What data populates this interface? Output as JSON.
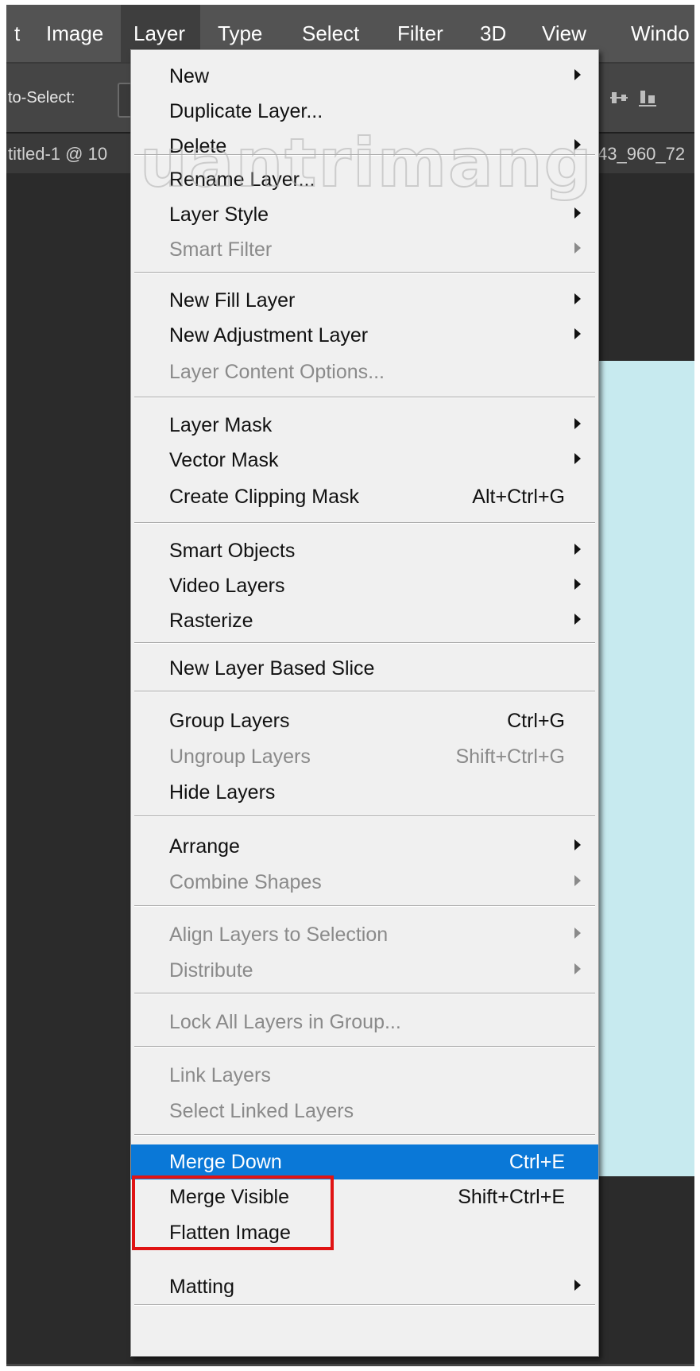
{
  "menubar": {
    "items": [
      {
        "label": "t"
      },
      {
        "label": "Image"
      },
      {
        "label": "Layer"
      },
      {
        "label": "Type"
      },
      {
        "label": "Select"
      },
      {
        "label": "Filter"
      },
      {
        "label": "3D"
      },
      {
        "label": "View"
      },
      {
        "label": "Windo"
      }
    ]
  },
  "options": {
    "label": "to-Select:"
  },
  "tabs": {
    "left": "titled-1 @ 10",
    "right": "43_960_72"
  },
  "watermark": "uantrimang",
  "layer_menu": {
    "items": [
      {
        "label": "New",
        "shortcut": "",
        "submenu": true,
        "disabled": false
      },
      {
        "label": "Duplicate Layer...",
        "shortcut": "",
        "submenu": false,
        "disabled": false
      },
      {
        "label": "Delete",
        "shortcut": "",
        "submenu": true,
        "disabled": false
      },
      {
        "label": "Rename Layer...",
        "shortcut": "",
        "submenu": false,
        "disabled": false
      },
      {
        "label": "Layer Style",
        "shortcut": "",
        "submenu": true,
        "disabled": false
      },
      {
        "label": "Smart Filter",
        "shortcut": "",
        "submenu": true,
        "disabled": true
      },
      {
        "label": "New Fill Layer",
        "shortcut": "",
        "submenu": true,
        "disabled": false
      },
      {
        "label": "New Adjustment Layer",
        "shortcut": "",
        "submenu": true,
        "disabled": false
      },
      {
        "label": "Layer Content Options...",
        "shortcut": "",
        "submenu": false,
        "disabled": true
      },
      {
        "label": "Layer Mask",
        "shortcut": "",
        "submenu": true,
        "disabled": false
      },
      {
        "label": "Vector Mask",
        "shortcut": "",
        "submenu": true,
        "disabled": false
      },
      {
        "label": "Create Clipping Mask",
        "shortcut": "Alt+Ctrl+G",
        "submenu": false,
        "disabled": false
      },
      {
        "label": "Smart Objects",
        "shortcut": "",
        "submenu": true,
        "disabled": false
      },
      {
        "label": "Video Layers",
        "shortcut": "",
        "submenu": true,
        "disabled": false
      },
      {
        "label": "Rasterize",
        "shortcut": "",
        "submenu": true,
        "disabled": false
      },
      {
        "label": "New Layer Based Slice",
        "shortcut": "",
        "submenu": false,
        "disabled": false
      },
      {
        "label": "Group Layers",
        "shortcut": "Ctrl+G",
        "submenu": false,
        "disabled": false
      },
      {
        "label": "Ungroup Layers",
        "shortcut": "Shift+Ctrl+G",
        "submenu": false,
        "disabled": true
      },
      {
        "label": "Hide Layers",
        "shortcut": "",
        "submenu": false,
        "disabled": false
      },
      {
        "label": "Arrange",
        "shortcut": "",
        "submenu": true,
        "disabled": false
      },
      {
        "label": "Combine Shapes",
        "shortcut": "",
        "submenu": true,
        "disabled": true
      },
      {
        "label": "Align Layers to Selection",
        "shortcut": "",
        "submenu": true,
        "disabled": true
      },
      {
        "label": "Distribute",
        "shortcut": "",
        "submenu": true,
        "disabled": true
      },
      {
        "label": "Lock All Layers in Group...",
        "shortcut": "",
        "submenu": false,
        "disabled": true
      },
      {
        "label": "Link Layers",
        "shortcut": "",
        "submenu": false,
        "disabled": true
      },
      {
        "label": "Select Linked Layers",
        "shortcut": "",
        "submenu": false,
        "disabled": true
      },
      {
        "label": "Merge Down",
        "shortcut": "Ctrl+E",
        "submenu": false,
        "disabled": false,
        "highlighted": true
      },
      {
        "label": "Merge Visible",
        "shortcut": "Shift+Ctrl+E",
        "submenu": false,
        "disabled": false
      },
      {
        "label": "Flatten Image",
        "shortcut": "",
        "submenu": false,
        "disabled": false
      },
      {
        "label": "Matting",
        "shortcut": "",
        "submenu": true,
        "disabled": false
      }
    ]
  },
  "colors": {
    "menu_bg": "#f0f0f0",
    "highlight": "#0a78d7",
    "annotation_box": "#e01313",
    "canvas": "#c7eaef"
  }
}
